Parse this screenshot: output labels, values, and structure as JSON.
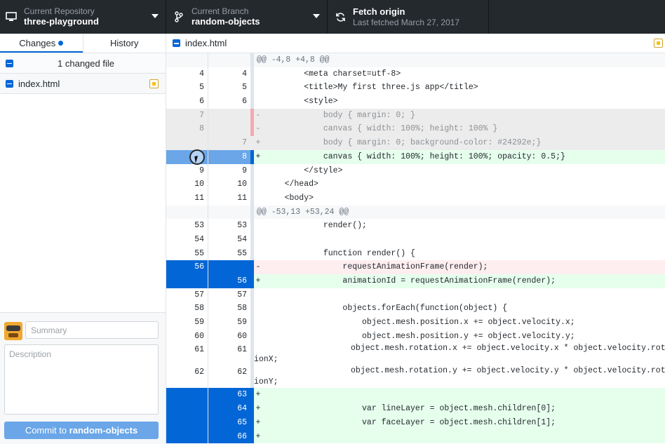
{
  "toolbar": {
    "repo_label": "Current Repository",
    "repo_value": "three-playground",
    "branch_label": "Current Branch",
    "branch_value": "random-objects",
    "fetch_label": "Fetch origin",
    "fetch_sub": "Last fetched March 27, 2017"
  },
  "sidebar": {
    "tab_changes": "Changes",
    "tab_history": "History",
    "changed_count": "1 changed file",
    "file": "index.html"
  },
  "commit": {
    "summary_placeholder": "Summary",
    "description_placeholder": "Description",
    "button_prefix": "Commit to ",
    "button_branch": "random-objects"
  },
  "diff": {
    "file": "index.html",
    "lines": [
      {
        "type": "hunk",
        "old": "",
        "new": "",
        "marker": "",
        "text": "@@ -4,8 +4,8 @@"
      },
      {
        "type": "ctx",
        "old": "4",
        "new": "4",
        "marker": "",
        "text": "        <meta charset=utf-8>"
      },
      {
        "type": "ctx",
        "old": "5",
        "new": "5",
        "marker": "",
        "text": "        <title>My first three.js app</title>"
      },
      {
        "type": "ctx",
        "old": "6",
        "new": "6",
        "marker": "",
        "text": "        <style>"
      },
      {
        "type": "del",
        "old": "7",
        "new": "",
        "marker": "-",
        "text": "            body { margin: 0; }"
      },
      {
        "type": "del",
        "old": "8",
        "new": "",
        "marker": "-",
        "text": "            canvas { width: 100%; height: 100% }"
      },
      {
        "type": "add-dim",
        "old": "",
        "new": "7",
        "marker": "+",
        "text": "            body { margin: 0; background-color: #24292e;}"
      },
      {
        "type": "add-sel",
        "old": "",
        "new": "8",
        "marker": "+",
        "text": "            canvas { width: 100%; height: 100%; opacity: 0.5;}"
      },
      {
        "type": "ctx",
        "old": "9",
        "new": "9",
        "marker": "",
        "text": "        </style>"
      },
      {
        "type": "ctx",
        "old": "10",
        "new": "10",
        "marker": "",
        "text": "    </head>"
      },
      {
        "type": "ctx",
        "old": "11",
        "new": "11",
        "marker": "",
        "text": "    <body>"
      },
      {
        "type": "hunk",
        "old": "",
        "new": "",
        "marker": "",
        "text": "@@ -53,13 +53,24 @@"
      },
      {
        "type": "ctx",
        "old": "53",
        "new": "53",
        "marker": "",
        "text": "            render();"
      },
      {
        "type": "ctx",
        "old": "54",
        "new": "54",
        "marker": "",
        "text": ""
      },
      {
        "type": "ctx",
        "old": "55",
        "new": "55",
        "marker": "",
        "text": "            function render() {"
      },
      {
        "type": "del-sel",
        "old": "56",
        "new": "",
        "marker": "-",
        "text": "                requestAnimationFrame(render);"
      },
      {
        "type": "add-full",
        "old": "",
        "new": "56",
        "marker": "+",
        "text": "                animationId = requestAnimationFrame(render);"
      },
      {
        "type": "ctx",
        "old": "57",
        "new": "57",
        "marker": "",
        "text": ""
      },
      {
        "type": "ctx",
        "old": "58",
        "new": "58",
        "marker": "",
        "text": "                objects.forEach(function(object) {"
      },
      {
        "type": "ctx",
        "old": "59",
        "new": "59",
        "marker": "",
        "text": "                    object.mesh.position.x += object.velocity.x;"
      },
      {
        "type": "ctx",
        "old": "60",
        "new": "60",
        "marker": "",
        "text": "                    object.mesh.position.y += object.velocity.y;"
      },
      {
        "type": "ctx",
        "old": "61",
        "new": "61",
        "marker": "",
        "text": "                    object.mesh.rotation.x += object.velocity.x * object.velocity.rotat\nionX;"
      },
      {
        "type": "ctx",
        "old": "62",
        "new": "62",
        "marker": "",
        "text": "                    object.mesh.rotation.y += object.velocity.y * object.velocity.rotat\nionY;"
      },
      {
        "type": "add-full",
        "old": "",
        "new": "63",
        "marker": "+",
        "text": ""
      },
      {
        "type": "add-full",
        "old": "",
        "new": "64",
        "marker": "+",
        "text": "                    var lineLayer = object.mesh.children[0];"
      },
      {
        "type": "add-full",
        "old": "",
        "new": "65",
        "marker": "+",
        "text": "                    var faceLayer = object.mesh.children[1];"
      },
      {
        "type": "add-full",
        "old": "",
        "new": "66",
        "marker": "+",
        "text": ""
      }
    ]
  }
}
